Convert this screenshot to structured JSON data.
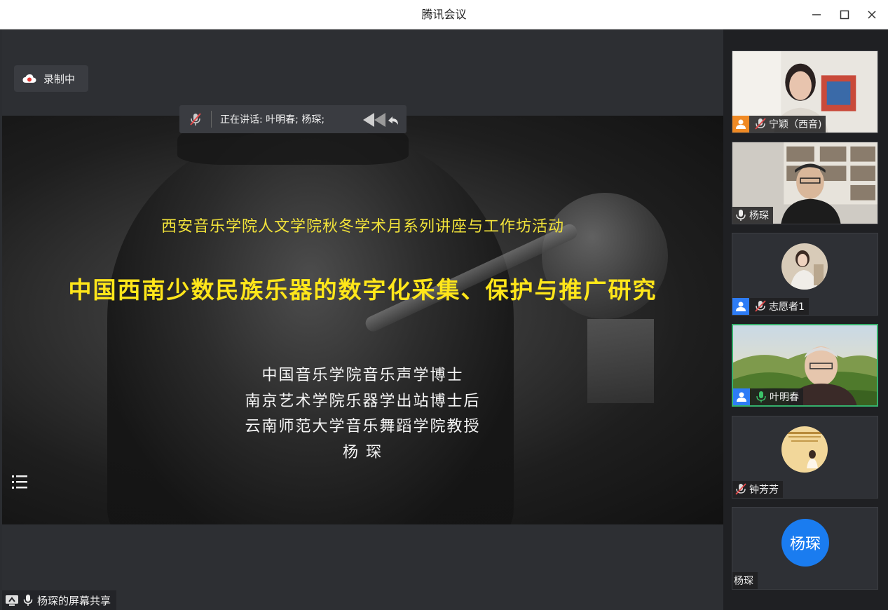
{
  "window": {
    "title": "腾讯会议"
  },
  "recording": {
    "label": "录制中"
  },
  "speaking": {
    "label": "正在讲话: 叶明春; 杨琛;"
  },
  "slide": {
    "subtitle": "西安音乐学院人文学院秋冬学术月系列讲座与工作坊活动",
    "title": "中国西南少数民族乐器的数字化采集、保护与推广研究",
    "credits": [
      "中国音乐学院音乐声学博士",
      "南京艺术学院乐器学出站博士后",
      "云南师范大学音乐舞蹈学院教授",
      "杨 琛"
    ]
  },
  "share": {
    "label": "杨琛的屏幕共享"
  },
  "participants": [
    {
      "name": "宁颖（西音)",
      "role_icon": "person-icon",
      "role_color": "#f08a24",
      "mic": "muted",
      "video": "woman-indoor"
    },
    {
      "name": "杨琛",
      "role_icon": "",
      "mic": "on",
      "video": "man-bookshelf"
    },
    {
      "name": "志愿者1",
      "role_icon": "person-icon",
      "role_color": "#2d7cf6",
      "mic": "muted",
      "video": "avatar-photo"
    },
    {
      "name": "叶明春",
      "role_icon": "person-icon",
      "role_color": "#2d7cf6",
      "mic": "speaking",
      "video": "landscape-elder"
    },
    {
      "name": "钟芳芳",
      "role_icon": "",
      "mic": "muted",
      "video": "avatar-poster"
    },
    {
      "name": "杨琛",
      "avatar_text": "杨琛",
      "role_icon": "",
      "mic": "none",
      "video": "avatar-initials"
    }
  ],
  "colors": {
    "speaking_border": "#35b06c",
    "host_orange": "#f08a24",
    "cohost_blue": "#2d7cf6",
    "mic_on_green": "#3cc36a",
    "mic_muted_red": "#e34a4a"
  }
}
